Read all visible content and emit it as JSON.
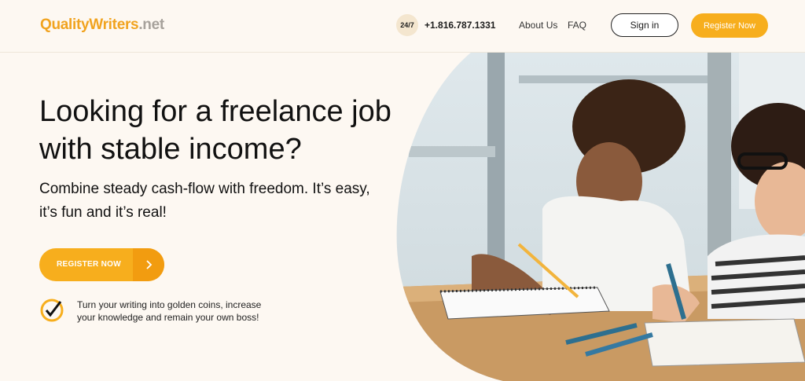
{
  "header": {
    "logo_part1": "QualityWriters",
    "logo_part2": ".net",
    "badge": "24/7",
    "phone": "+1.816.787.1331",
    "nav": {
      "about": "About Us",
      "faq": "FAQ"
    },
    "signin_label": "Sign in",
    "register_label": "Register Now"
  },
  "hero": {
    "title": "Looking for a freelance job with stable income?",
    "subtitle": "Combine steady cash-flow with freedom. It’s easy, it’s fun and it’s real!",
    "cta_label": "REGISTER NOW",
    "bullet": "Turn your writing into golden coins, increase your knowledge and remain your own boss!"
  },
  "colors": {
    "accent": "#f7ae1d",
    "background": "#fdf8f2",
    "text": "#111111"
  },
  "icons": [
    "chevron-right-icon",
    "check-badge-icon"
  ]
}
